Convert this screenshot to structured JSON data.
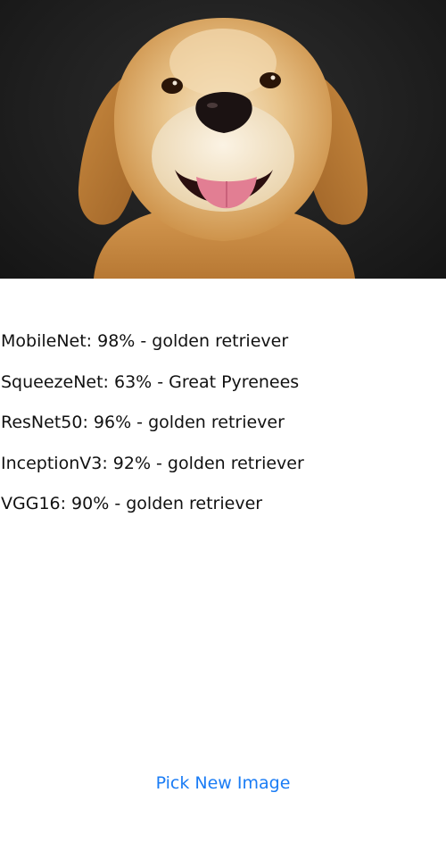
{
  "image": {
    "subject": "golden retriever photo"
  },
  "results": [
    {
      "text": "MobileNet: 98% - golden retriever"
    },
    {
      "text": "SqueezeNet: 63% - Great Pyrenees"
    },
    {
      "text": "ResNet50: 96% - golden retriever"
    },
    {
      "text": "InceptionV3: 92% - golden retriever"
    },
    {
      "text": "VGG16: 90% - golden retriever"
    }
  ],
  "actions": {
    "pick_label": "Pick New Image"
  },
  "colors": {
    "accent": "#1a7cf5",
    "text": "#111111",
    "photo_bg": "#1f1f1f",
    "fur": "#d9a45c"
  }
}
